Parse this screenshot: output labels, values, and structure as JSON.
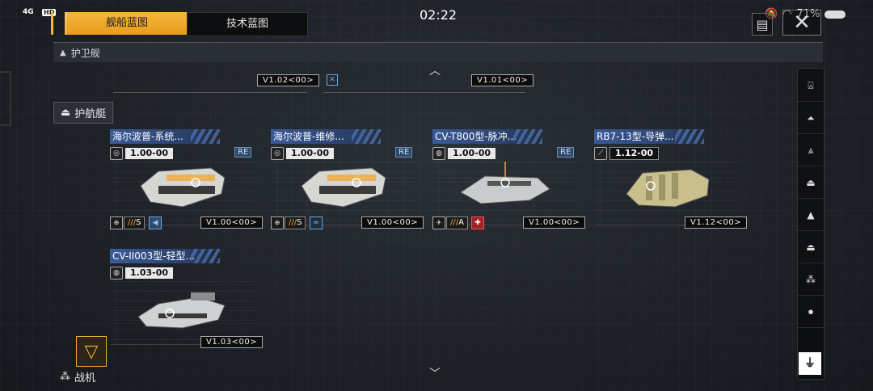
{
  "status": {
    "signal": "4G",
    "hd": "HD",
    "time": "02:22",
    "battery": "71%"
  },
  "tabs": [
    {
      "label": "舰船蓝图",
      "active": true
    },
    {
      "label": "技术蓝图",
      "active": false
    }
  ],
  "icons": {
    "notes": "notes-icon",
    "close": "close-icon",
    "filter": "filter-icon",
    "up": "chevron-up-icon",
    "down": "chevron-down-icon"
  },
  "categories": {
    "frigate": "护卫舰",
    "escort": "护航艇",
    "fighter": "战机"
  },
  "top_row": {
    "ver1": "V1.02<00>",
    "ver2": "V1.01<00>"
  },
  "ships": [
    {
      "name": "海尔波普-系统...",
      "rate": "1.00-00",
      "grade": "S",
      "version": "V1.00<00>",
      "re": "RE",
      "ship_color": "#d7d7d2"
    },
    {
      "name": "海尔波普-维修...",
      "rate": "1.00-00",
      "grade": "S",
      "version": "V1.00<00>",
      "re": "RE",
      "ship_color": "#d7d7d2"
    },
    {
      "name": "CV-T800型-脉冲...",
      "rate": "1.00-00",
      "grade": "A",
      "version": "V1.00<00>",
      "re": "RE",
      "ship_color": "#c9cccd"
    },
    {
      "name": "RB7-13型-导弹...",
      "rate": "1.12-00",
      "grade": "",
      "version": "V1.12<00>",
      "re": "",
      "ship_color": "#c8bf8c"
    },
    {
      "name": "CV-II003型-轻型...",
      "rate": "1.03-00",
      "grade": "",
      "version": "V1.03<00>",
      "re": "",
      "ship_color": "#cfd2d3"
    }
  ],
  "colors": {
    "accent": "#f2a93a",
    "name_bar": "#3a5a9a",
    "re": "#2e4a6a"
  }
}
